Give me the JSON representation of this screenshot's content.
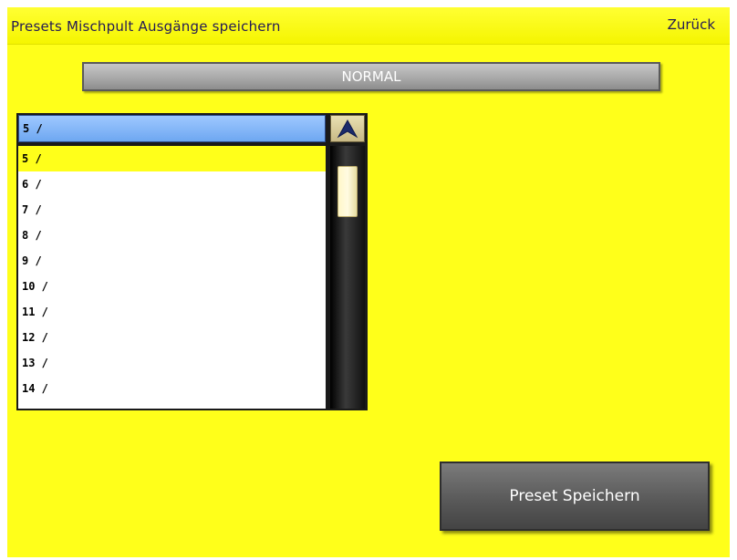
{
  "header": {
    "title": "Presets Mischpult Ausgänge speichern",
    "back_label": "Zurück"
  },
  "mode": {
    "label": "NORMAL"
  },
  "preset_list": {
    "selected_value": "5 /",
    "items": [
      "5 /",
      "6 /",
      "7 /",
      "8 /",
      "9 /",
      "10 /",
      "11 /",
      "12 /",
      "13 /",
      "14 /"
    ],
    "selected_index": 0
  },
  "actions": {
    "save_label": "Preset Speichern"
  },
  "colors": {
    "background": "#ffff1a",
    "title_text": "#241a55",
    "combo_highlight": "#6ea7f1",
    "button_gray": "#5a5a5a"
  },
  "icons": {
    "scroll_up": "chevron-up-icon"
  }
}
